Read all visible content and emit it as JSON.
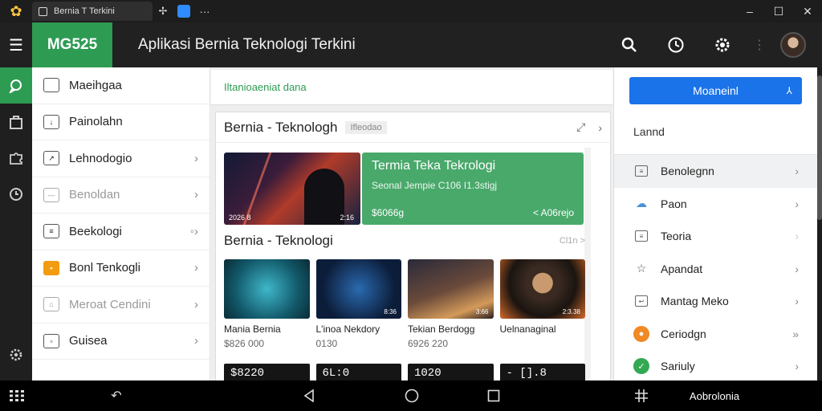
{
  "window": {
    "tab_title": "Bernia T Terkini"
  },
  "header": {
    "brand": "MG525",
    "title": "Aplikasi Bernia Teknologi Terkini"
  },
  "sidebar": {
    "items": [
      {
        "label": "Maeihgaa"
      },
      {
        "label": "Painolahn"
      },
      {
        "label": "Lehnodogio"
      },
      {
        "label": "Benoldan"
      },
      {
        "label": "Beekologi"
      },
      {
        "label": "Bonl Tenkogli"
      },
      {
        "label": "Meroat Cendini"
      },
      {
        "label": "Guisea"
      }
    ]
  },
  "main": {
    "notice": "Iltanioaeniat dana",
    "card_title": "Bernia - Teknologh",
    "card_tag": "Ifleodao",
    "hero": {
      "img_caption_left": "2026 8",
      "img_caption_right": "2:16",
      "title": "Termia Teka Tekrologi",
      "subtitle": "Seonal Jempie C106 I1.3stigj",
      "bottom_left": "$6066g",
      "bottom_right": "< A06rejo"
    },
    "section_title": "Bernia - Teknologi",
    "section_more": "Cl1n >",
    "thumbs": [
      {
        "name": "Mania Bernia",
        "value": "$826 000",
        "badge": ""
      },
      {
        "name": "L'inoa Nekdory",
        "value": "0130",
        "badge": "8:36"
      },
      {
        "name": "Tekian Berdogg",
        "value": "6926 220",
        "badge": "3:66"
      },
      {
        "name": "Uelnanaginal",
        "value": "",
        "badge": "2:3.38"
      }
    ],
    "counters": [
      "$8220",
      "6L:0",
      "1020",
      "- [].8"
    ]
  },
  "right_panel": {
    "button": "Moaneinl",
    "label": "Lannd",
    "items": [
      {
        "label": "Benolegnn"
      },
      {
        "label": "Paon"
      },
      {
        "label": "Teoria"
      },
      {
        "label": "Apandat"
      },
      {
        "label": "Mantag Meko"
      },
      {
        "label": "Ceriodgn"
      },
      {
        "label": "Sariuly"
      }
    ]
  },
  "navbar": {
    "label": "Aobrolonia"
  }
}
